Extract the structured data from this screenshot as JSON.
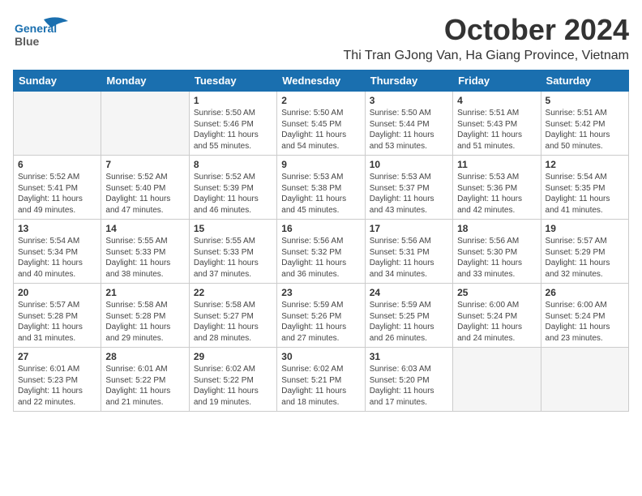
{
  "header": {
    "logo_line1": "General",
    "logo_line2": "Blue",
    "month_title": "October 2024",
    "subtitle": "Thi Tran GJong Van, Ha Giang Province, Vietnam"
  },
  "days_of_week": [
    "Sunday",
    "Monday",
    "Tuesday",
    "Wednesday",
    "Thursday",
    "Friday",
    "Saturday"
  ],
  "weeks": [
    [
      {
        "day": "",
        "info": ""
      },
      {
        "day": "",
        "info": ""
      },
      {
        "day": "1",
        "info": "Sunrise: 5:50 AM\nSunset: 5:46 PM\nDaylight: 11 hours\nand 55 minutes."
      },
      {
        "day": "2",
        "info": "Sunrise: 5:50 AM\nSunset: 5:45 PM\nDaylight: 11 hours\nand 54 minutes."
      },
      {
        "day": "3",
        "info": "Sunrise: 5:50 AM\nSunset: 5:44 PM\nDaylight: 11 hours\nand 53 minutes."
      },
      {
        "day": "4",
        "info": "Sunrise: 5:51 AM\nSunset: 5:43 PM\nDaylight: 11 hours\nand 51 minutes."
      },
      {
        "day": "5",
        "info": "Sunrise: 5:51 AM\nSunset: 5:42 PM\nDaylight: 11 hours\nand 50 minutes."
      }
    ],
    [
      {
        "day": "6",
        "info": "Sunrise: 5:52 AM\nSunset: 5:41 PM\nDaylight: 11 hours\nand 49 minutes."
      },
      {
        "day": "7",
        "info": "Sunrise: 5:52 AM\nSunset: 5:40 PM\nDaylight: 11 hours\nand 47 minutes."
      },
      {
        "day": "8",
        "info": "Sunrise: 5:52 AM\nSunset: 5:39 PM\nDaylight: 11 hours\nand 46 minutes."
      },
      {
        "day": "9",
        "info": "Sunrise: 5:53 AM\nSunset: 5:38 PM\nDaylight: 11 hours\nand 45 minutes."
      },
      {
        "day": "10",
        "info": "Sunrise: 5:53 AM\nSunset: 5:37 PM\nDaylight: 11 hours\nand 43 minutes."
      },
      {
        "day": "11",
        "info": "Sunrise: 5:53 AM\nSunset: 5:36 PM\nDaylight: 11 hours\nand 42 minutes."
      },
      {
        "day": "12",
        "info": "Sunrise: 5:54 AM\nSunset: 5:35 PM\nDaylight: 11 hours\nand 41 minutes."
      }
    ],
    [
      {
        "day": "13",
        "info": "Sunrise: 5:54 AM\nSunset: 5:34 PM\nDaylight: 11 hours\nand 40 minutes."
      },
      {
        "day": "14",
        "info": "Sunrise: 5:55 AM\nSunset: 5:33 PM\nDaylight: 11 hours\nand 38 minutes."
      },
      {
        "day": "15",
        "info": "Sunrise: 5:55 AM\nSunset: 5:33 PM\nDaylight: 11 hours\nand 37 minutes."
      },
      {
        "day": "16",
        "info": "Sunrise: 5:56 AM\nSunset: 5:32 PM\nDaylight: 11 hours\nand 36 minutes."
      },
      {
        "day": "17",
        "info": "Sunrise: 5:56 AM\nSunset: 5:31 PM\nDaylight: 11 hours\nand 34 minutes."
      },
      {
        "day": "18",
        "info": "Sunrise: 5:56 AM\nSunset: 5:30 PM\nDaylight: 11 hours\nand 33 minutes."
      },
      {
        "day": "19",
        "info": "Sunrise: 5:57 AM\nSunset: 5:29 PM\nDaylight: 11 hours\nand 32 minutes."
      }
    ],
    [
      {
        "day": "20",
        "info": "Sunrise: 5:57 AM\nSunset: 5:28 PM\nDaylight: 11 hours\nand 31 minutes."
      },
      {
        "day": "21",
        "info": "Sunrise: 5:58 AM\nSunset: 5:28 PM\nDaylight: 11 hours\nand 29 minutes."
      },
      {
        "day": "22",
        "info": "Sunrise: 5:58 AM\nSunset: 5:27 PM\nDaylight: 11 hours\nand 28 minutes."
      },
      {
        "day": "23",
        "info": "Sunrise: 5:59 AM\nSunset: 5:26 PM\nDaylight: 11 hours\nand 27 minutes."
      },
      {
        "day": "24",
        "info": "Sunrise: 5:59 AM\nSunset: 5:25 PM\nDaylight: 11 hours\nand 26 minutes."
      },
      {
        "day": "25",
        "info": "Sunrise: 6:00 AM\nSunset: 5:24 PM\nDaylight: 11 hours\nand 24 minutes."
      },
      {
        "day": "26",
        "info": "Sunrise: 6:00 AM\nSunset: 5:24 PM\nDaylight: 11 hours\nand 23 minutes."
      }
    ],
    [
      {
        "day": "27",
        "info": "Sunrise: 6:01 AM\nSunset: 5:23 PM\nDaylight: 11 hours\nand 22 minutes."
      },
      {
        "day": "28",
        "info": "Sunrise: 6:01 AM\nSunset: 5:22 PM\nDaylight: 11 hours\nand 21 minutes."
      },
      {
        "day": "29",
        "info": "Sunrise: 6:02 AM\nSunset: 5:22 PM\nDaylight: 11 hours\nand 19 minutes."
      },
      {
        "day": "30",
        "info": "Sunrise: 6:02 AM\nSunset: 5:21 PM\nDaylight: 11 hours\nand 18 minutes."
      },
      {
        "day": "31",
        "info": "Sunrise: 6:03 AM\nSunset: 5:20 PM\nDaylight: 11 hours\nand 17 minutes."
      },
      {
        "day": "",
        "info": ""
      },
      {
        "day": "",
        "info": ""
      }
    ]
  ]
}
